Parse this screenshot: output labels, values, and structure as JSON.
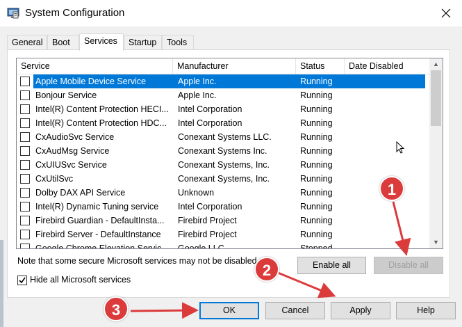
{
  "window": {
    "title": "System Configuration",
    "icon": "msconfig-icon",
    "close_icon": "close-icon"
  },
  "tabs": [
    {
      "label": "General"
    },
    {
      "label": "Boot"
    },
    {
      "label": "Services",
      "active": true
    },
    {
      "label": "Startup"
    },
    {
      "label": "Tools"
    }
  ],
  "columns": {
    "service": "Service",
    "manufacturer": "Manufacturer",
    "status": "Status",
    "date_disabled": "Date Disabled"
  },
  "services": [
    {
      "name": "Apple Mobile Device Service",
      "manufacturer": "Apple Inc.",
      "status": "Running",
      "selected": true
    },
    {
      "name": "Bonjour Service",
      "manufacturer": "Apple Inc.",
      "status": "Running"
    },
    {
      "name": "Intel(R) Content Protection HECI...",
      "manufacturer": "Intel Corporation",
      "status": "Running"
    },
    {
      "name": "Intel(R) Content Protection HDC...",
      "manufacturer": "Intel Corporation",
      "status": "Running"
    },
    {
      "name": "CxAudioSvc Service",
      "manufacturer": "Conexant Systems LLC.",
      "status": "Running"
    },
    {
      "name": "CxAudMsg Service",
      "manufacturer": "Conexant Systems Inc.",
      "status": "Running"
    },
    {
      "name": "CxUIUSvc Service",
      "manufacturer": "Conexant Systems, Inc.",
      "status": "Running"
    },
    {
      "name": "CxUtilSvc",
      "manufacturer": "Conexant Systems, Inc.",
      "status": "Running"
    },
    {
      "name": "Dolby DAX API Service",
      "manufacturer": "Unknown",
      "status": "Running"
    },
    {
      "name": "Intel(R) Dynamic Tuning service",
      "manufacturer": "Intel Corporation",
      "status": "Running"
    },
    {
      "name": "Firebird Guardian - DefaultInsta...",
      "manufacturer": "Firebird Project",
      "status": "Running"
    },
    {
      "name": "Firebird Server - DefaultInstance",
      "manufacturer": "Firebird Project",
      "status": "Running"
    },
    {
      "name": "Google Chrome Elevation Servic...",
      "manufacturer": "Google LLC",
      "status": "Stopped"
    }
  ],
  "note": "Note that some secure Microsoft services may not be disabled.",
  "buttons": {
    "enable_all": "Enable all",
    "disable_all": "Disable all",
    "ok": "OK",
    "cancel": "Cancel",
    "apply": "Apply",
    "help": "Help"
  },
  "hide_ms": {
    "label": "Hide all Microsoft services",
    "checked": true
  },
  "annotations": {
    "badge1": "1",
    "badge2": "2",
    "badge3": "3",
    "color": "#dc3b3b"
  },
  "colors": {
    "selection": "#0078d7",
    "accent_border": "#0078d7"
  }
}
